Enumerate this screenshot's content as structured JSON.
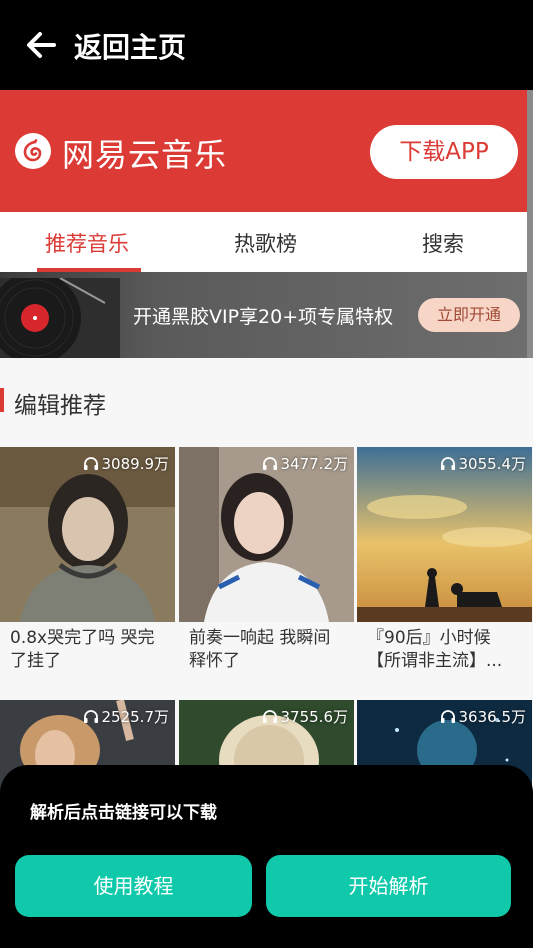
{
  "topbar": {
    "title": "返回主页",
    "back_icon": "arrow-left-icon"
  },
  "brand": {
    "name": "网易云音乐",
    "download_label": "下载APP",
    "color": "#db3a35"
  },
  "tabs": [
    {
      "label": "推荐音乐",
      "active": true
    },
    {
      "label": "热歌榜",
      "active": false
    },
    {
      "label": "搜索",
      "active": false
    }
  ],
  "vip_banner": {
    "text": "开通黑胶VIP享20+项专属特权",
    "button": "立即开通"
  },
  "section": {
    "title": "编辑推荐"
  },
  "playlists": [
    {
      "plays": "3089.9万",
      "title_line1": "0.8x哭完了吗 哭完",
      "title_line2": "了挂了"
    },
    {
      "plays": "3477.2万",
      "title_line1": "前奏一响起 我瞬间",
      "title_line2": "释怀了"
    },
    {
      "plays": "3055.4万",
      "title_line1": "『90后』小时候",
      "title_line2": "【所谓非主流】..."
    },
    {
      "plays": "2525.7万",
      "title_line1": "",
      "title_line2": ""
    },
    {
      "plays": "3755.6万",
      "title_line1": "",
      "title_line2": ""
    },
    {
      "plays": "3636.5万",
      "title_line1": "",
      "title_line2": ""
    }
  ],
  "sheet": {
    "message": "解析后点击链接可以下载",
    "tutorial_button": "使用教程",
    "parse_button": "开始解析",
    "button_color": "#10c9ab"
  }
}
